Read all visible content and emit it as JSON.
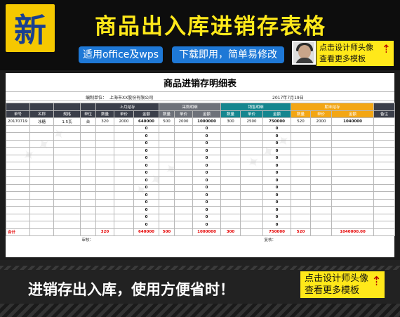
{
  "banner": {
    "badge": "新",
    "title": "商品出入库进销存表格",
    "pill_office": "适用office及wps",
    "pill_download": "下载即用，简单易修改",
    "promo_line1": "点击设计师头像",
    "promo_line2": "查看更多模板"
  },
  "sheet": {
    "title": "商品进销存明细表",
    "unit_label": "编制单位：",
    "unit_value": "上海市XX股份有限公司",
    "date": "2017年7月19日",
    "group_headers": {
      "opening": "上月结存",
      "purchase": "采购明细",
      "sales": "销售明细",
      "closing": "期末结存"
    },
    "columns": [
      "单号",
      "名称",
      "规格",
      "单位",
      "数量",
      "单价",
      "金额",
      "数量",
      "单价",
      "金额",
      "数量",
      "单价",
      "金额",
      "数量",
      "单价",
      "金额",
      "备注"
    ],
    "first_row": [
      "20170719",
      "冰糖",
      "1.5瓦",
      "台",
      "320",
      "2000",
      "640000",
      "500",
      "2000",
      "1000000",
      "300",
      "2500",
      "750000",
      "520",
      "2000",
      "1040000",
      ""
    ],
    "zero_value": "0",
    "empty_row_count": 14,
    "total_row": {
      "label": "合计",
      "opening_qty": "320",
      "opening_amount": "640000",
      "purchase_qty": "500",
      "purchase_amount": "1000000",
      "sales_qty": "300",
      "sales_amount": "750000",
      "closing_qty": "520",
      "closing_amount": "1040000.00"
    },
    "audit_label": "审核：",
    "review_label": "复核："
  },
  "bottom": {
    "slogan": "进销存出入库，使用方便省时！",
    "promo_line1": "点击设计师头像",
    "promo_line2": "查看更多模板"
  },
  "colors": {
    "accent_yellow": "#ffe81a",
    "header_dark": "#3b3f4a",
    "header_teal": "#15868f",
    "header_gold": "#f3a614",
    "total_red": "#e60000"
  }
}
